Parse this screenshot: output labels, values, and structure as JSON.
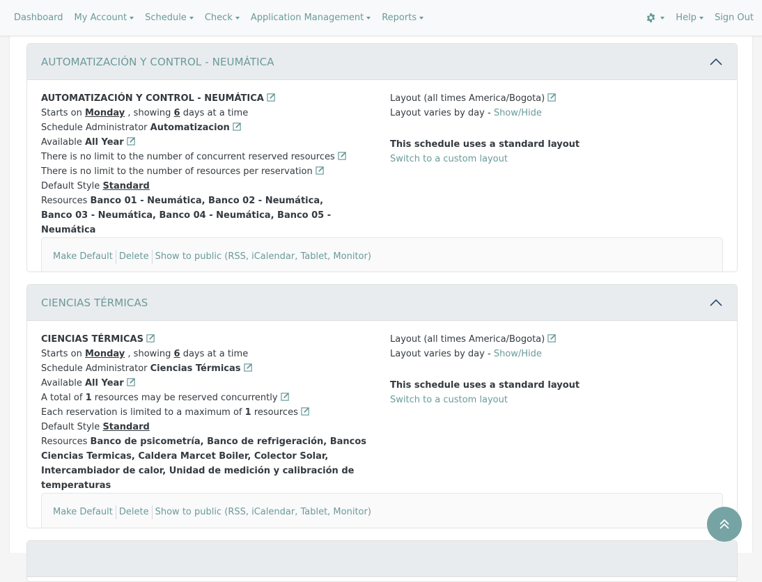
{
  "nav": {
    "left": [
      {
        "label": "Dashboard",
        "dropdown": false
      },
      {
        "label": "My Account",
        "dropdown": true
      },
      {
        "label": "Schedule",
        "dropdown": true
      },
      {
        "label": "Check",
        "dropdown": true
      },
      {
        "label": "Application Management",
        "dropdown": true
      },
      {
        "label": "Reports",
        "dropdown": true
      }
    ],
    "settings_icon": "gear-icon",
    "help": "Help",
    "sign_out": "Sign Out"
  },
  "colors": {
    "link": "#6a9a9a",
    "header_bg": "#e9ecef",
    "to_top_button": "#76a3a3"
  },
  "schedules": [
    {
      "header": "AUTOMATIZACIÓN Y CONTROL - NEUMÁTICA",
      "name": "AUTOMATIZACIÓN Y CONTROL - NEUMÁTICA",
      "starts_prefix": "Starts on",
      "starts_day": "Monday",
      "showing_prefix": ", showing",
      "days": "6",
      "showing_suffix": "days at a time",
      "admin_label": "Schedule Administrator",
      "admin": "Automatizacion",
      "available_label": "Available",
      "available": "All Year",
      "concurrent_text": "There is no limit to the number of concurrent reserved resources",
      "per_reservation_text": "There is no limit to the number of resources per reservation",
      "style_label": "Default Style",
      "style": "Standard",
      "resources_label": "Resources",
      "resources": "Banco 01 - Neumática, Banco 02 - Neumática, Banco 03 - Neumática, Banco 04 - Neumática, Banco 05 - Neumática",
      "layout_label": "Layout (all times America/Bogota)",
      "layout_varies": "Layout varies by day -",
      "show_hide": "Show/Hide",
      "standard_layout": "This schedule uses a standard layout",
      "switch_custom": "Switch to a custom layout",
      "actions": [
        "Make Default",
        "Delete",
        "Show to public (RSS, iCalendar, Tablet, Monitor)"
      ]
    },
    {
      "header": "CIENCIAS TÉRMICAS",
      "name": "CIENCIAS TÉRMICAS",
      "starts_prefix": "Starts on",
      "starts_day": "Monday",
      "showing_prefix": ", showing",
      "days": "6",
      "showing_suffix": "days at a time",
      "admin_label": "Schedule Administrator",
      "admin": "Ciencias Térmicas",
      "available_label": "Available",
      "available": "All Year",
      "concurrent_prefix": "A total of",
      "concurrent_value": "1",
      "concurrent_suffix": "resources may be reserved concurrently",
      "per_reservation_prefix": "Each reservation is limited to a maximum of",
      "per_reservation_value": "1",
      "per_reservation_suffix": "resources",
      "style_label": "Default Style",
      "style": "Standard",
      "resources_label": "Resources",
      "resources": "Banco de psicometría, Banco de refrigeración, Bancos Ciencias Termicas, Caldera Marcet Boiler, Colector Solar, Intercambiador de calor, Unidad de medición y calibración de temperaturas",
      "layout_label": "Layout (all times America/Bogota)",
      "layout_varies": "Layout varies by day -",
      "show_hide": "Show/Hide",
      "standard_layout": "This schedule uses a standard layout",
      "switch_custom": "Switch to a custom layout",
      "actions": [
        "Make Default",
        "Delete",
        "Show to public (RSS, iCalendar, Tablet, Monitor)"
      ]
    }
  ],
  "scroll_top_icon": "double-chevron-up-icon"
}
